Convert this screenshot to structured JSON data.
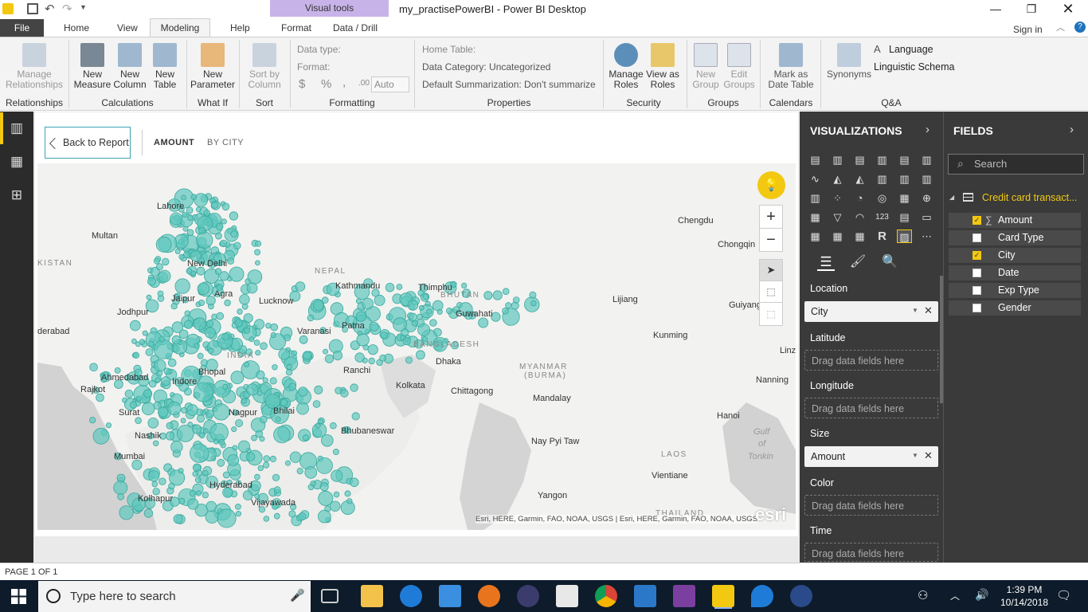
{
  "title_bar": {
    "context_label": "Visual tools",
    "window_title": "my_practisePowerBI - Power BI Desktop"
  },
  "tabs": {
    "file": "File",
    "home": "Home",
    "view": "View",
    "modeling": "Modeling",
    "help": "Help",
    "format": "Format",
    "data_drill": "Data / Drill",
    "sign_in": "Sign in"
  },
  "ribbon": {
    "manage_relationships": [
      "Manage",
      "Relationships"
    ],
    "new_measure": [
      "New",
      "Measure"
    ],
    "new_column": [
      "New",
      "Column"
    ],
    "new_table": [
      "New",
      "Table"
    ],
    "new_parameter": [
      "New",
      "Parameter"
    ],
    "sort_by_column": [
      "Sort by",
      "Column"
    ],
    "data_type": "Data type:",
    "format": "Format:",
    "auto": "Auto",
    "home_table": "Home Table:",
    "data_category": "Data Category: Uncategorized",
    "default_summarization": "Default Summarization: Don't summarize",
    "manage_roles": [
      "Manage",
      "Roles"
    ],
    "view_as_roles": [
      "View as",
      "Roles"
    ],
    "new_group": [
      "New",
      "Group"
    ],
    "edit_groups": [
      "Edit",
      "Groups"
    ],
    "mark_as_date_table": [
      "Mark as",
      "Date Table"
    ],
    "synonyms": "Synonyms",
    "language": "Language",
    "linguistic_schema": "Linguistic Schema",
    "groups": {
      "relationships": "Relationships",
      "calculations": "Calculations",
      "what_if": "What If",
      "sort": "Sort",
      "formatting": "Formatting",
      "properties": "Properties",
      "security": "Security",
      "groups": "Groups",
      "calendars": "Calendars",
      "qa": "Q&A"
    }
  },
  "report": {
    "back_button": "Back to Report",
    "amount": "AMOUNT",
    "by_city": "BY CITY",
    "page_indicator": "PAGE 1 OF 1"
  },
  "map": {
    "labels": [
      "Lahore",
      "Multan",
      "KISTAN",
      "New Delhi",
      "NEPAL",
      "Kathmandu",
      "Thimphu",
      "BHUTAN",
      "Jaipur",
      "Agra",
      "Lucknow",
      "Jodhpur",
      "Guwahati",
      "Varanasi",
      "Patna",
      "derabad",
      "INDIA",
      "Bhopal",
      "Ahmedabad",
      "BANGLADESH",
      "Dhaka",
      "Ranchi",
      "Indore",
      "Kolkata",
      "Rajkot",
      "Chittagong",
      "MYANMAR",
      "(BURMA)",
      "Mandalay",
      "Surat",
      "Nagpur",
      "Bhilai",
      "Bhubaneswar",
      "Nashik",
      "Mumbai",
      "Nay Pyi Taw",
      "Hyderabad",
      "Yangon",
      "Kolhapur",
      "Vijayawada",
      "Chengdu",
      "Chongqin",
      "Lijiang",
      "Guiyang",
      "Kunming",
      "Nanning",
      "Hanoi",
      "Gulf",
      "of",
      "Tonkin",
      "LAOS",
      "Vientiane",
      "THAILAND",
      "Linz"
    ],
    "attribution": "Esri, HERE, Garmin, FAO, NOAA, USGS | Esri, HERE, Garmin, FAO, NOAA, USGS",
    "logo": "esri",
    "bubble_color": "#5fc8bd"
  },
  "visualizations": {
    "title": "VISUALIZATIONS",
    "location_label": "Location",
    "location_value": "City",
    "latitude_label": "Latitude",
    "longitude_label": "Longitude",
    "size_label": "Size",
    "size_value": "Amount",
    "color_label": "Color",
    "time_label": "Time",
    "drag_hint": "Drag data fields here"
  },
  "fields": {
    "title": "FIELDS",
    "search_placeholder": "Search",
    "table_name": "Credit card transact...",
    "items": [
      {
        "label": "Amount",
        "checked": true,
        "sigma": true
      },
      {
        "label": "Card Type",
        "checked": false
      },
      {
        "label": "City",
        "checked": true
      },
      {
        "label": "Date",
        "checked": false
      },
      {
        "label": "Exp Type",
        "checked": false
      },
      {
        "label": "Gender",
        "checked": false
      }
    ]
  },
  "taskbar": {
    "search_placeholder": "Type here to search",
    "time": "1:39 PM",
    "date": "10/14/2018"
  },
  "colors": {
    "accent_yellow": "#f2c811",
    "context_purple": "#c8b3e8",
    "pane_dark": "#3a3a3a",
    "teal": "#3ba3b0"
  }
}
